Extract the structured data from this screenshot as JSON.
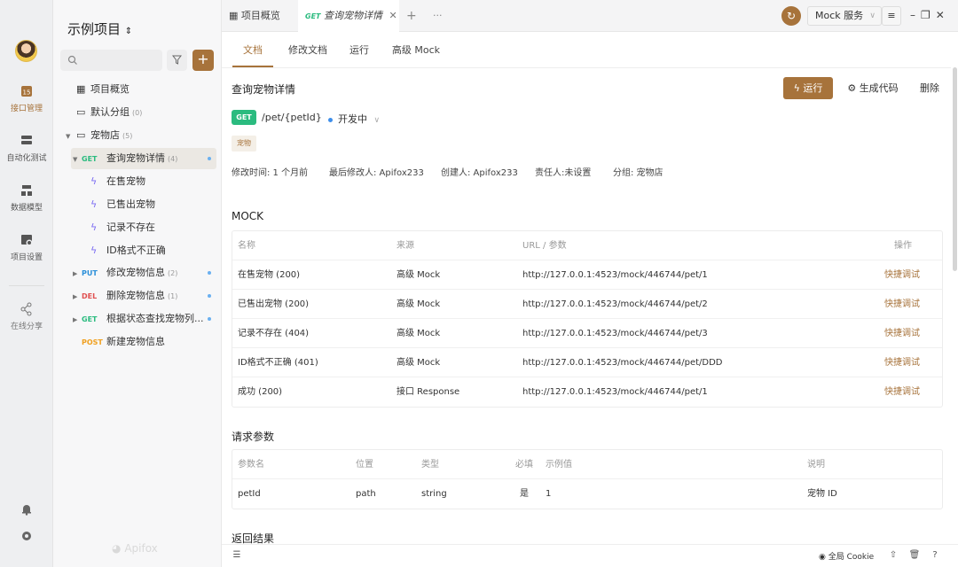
{
  "rail": {
    "items": [
      {
        "label": "接口管理",
        "icon": "api-management-icon"
      },
      {
        "label": "自动化测试",
        "icon": "automation-test-icon"
      },
      {
        "label": "数据模型",
        "icon": "data-model-icon"
      },
      {
        "label": "项目设置",
        "icon": "project-settings-icon"
      },
      {
        "label": "在线分享",
        "icon": "share-icon"
      }
    ]
  },
  "tree": {
    "project_title": "示例项目",
    "search_placeholder": "",
    "add_label": "+",
    "overview_label": "项目概览",
    "default_group": {
      "label": "默认分组",
      "count": "(0)"
    },
    "pet_store": {
      "label": "宠物店",
      "count": "(5)"
    },
    "endpoints": [
      {
        "method": "GET",
        "label": "查询宠物详情",
        "count": "(4)"
      },
      {
        "method": "PUT",
        "label": "修改宠物信息",
        "count": "(2)"
      },
      {
        "method": "DEL",
        "label": "删除宠物信息",
        "count": "(1)"
      },
      {
        "method": "GET",
        "label": "根据状态查找宠物列...",
        "count": ""
      },
      {
        "method": "POST",
        "label": "新建宠物信息",
        "count": ""
      }
    ],
    "cases": [
      "在售宠物",
      "已售出宠物",
      "记录不存在",
      "ID格式不正确"
    ],
    "watermark": "Apifox"
  },
  "tabs": {
    "overview": "项目概览",
    "active_method": "GET",
    "active_label": "查询宠物详情",
    "add": "+",
    "more": "···",
    "env": "Mock 服务"
  },
  "doc_tabs": [
    "文档",
    "修改文档",
    "运行",
    "高级 Mock"
  ],
  "endpoint": {
    "title": "查询宠物详情",
    "run": "运行",
    "gen_code": "生成代码",
    "delete": "删除",
    "method": "GET",
    "path": "/pet/{petId}",
    "status": "开发中",
    "tag": "宠物",
    "meta": {
      "modified": "修改时间: 1 个月前",
      "modifier": "最后修改人: Apifox233",
      "creator": "创建人: Apifox233",
      "owner": "责任人:未设置",
      "group": "分组: 宠物店"
    }
  },
  "mock": {
    "title": "MOCK",
    "headers": [
      "名称",
      "来源",
      "URL / 参数",
      "操作"
    ],
    "rows": [
      {
        "name": "在售宠物 (200)",
        "source": "高级 Mock",
        "url": "http://127.0.0.1:4523/mock/446744/pet/1",
        "action": "快捷调试"
      },
      {
        "name": "已售出宠物 (200)",
        "source": "高级 Mock",
        "url": "http://127.0.0.1:4523/mock/446744/pet/2",
        "action": "快捷调试"
      },
      {
        "name": "记录不存在 (404)",
        "source": "高级 Mock",
        "url": "http://127.0.0.1:4523/mock/446744/pet/3",
        "action": "快捷调试"
      },
      {
        "name": "ID格式不正确 (401)",
        "source": "高级 Mock",
        "url": "http://127.0.0.1:4523/mock/446744/pet/DDD",
        "action": "快捷调试"
      },
      {
        "name": "成功 (200)",
        "source": "接口 Response",
        "url": "http://127.0.0.1:4523/mock/446744/pet/1",
        "action": "快捷调试"
      }
    ]
  },
  "params": {
    "title": "请求参数",
    "headers": [
      "参数名",
      "位置",
      "类型",
      "必填",
      "示例值",
      "说明"
    ],
    "rows": [
      {
        "name": "petId",
        "location": "path",
        "type": "string",
        "required": "是",
        "example": "1",
        "desc": "宠物 ID"
      }
    ]
  },
  "response_title": "返回结果",
  "bottom": {
    "cookie": "全局 Cookie"
  },
  "colors": {
    "accent": "#a7733b",
    "get": "#2bbb7f",
    "put": "#2b8fd9",
    "del": "#e05050",
    "post": "#f0a020"
  }
}
